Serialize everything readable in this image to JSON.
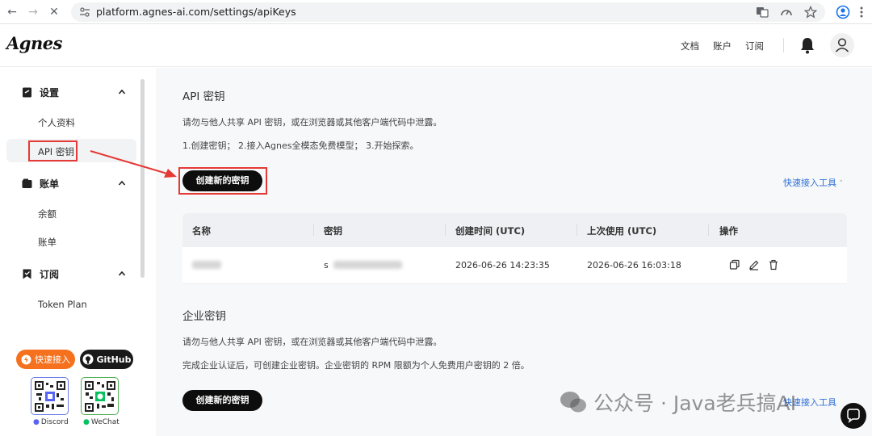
{
  "browser": {
    "url": "platform.agnes-ai.com/settings/apiKeys"
  },
  "header": {
    "logo": "Agnes",
    "links": [
      "文档",
      "账户",
      "订阅"
    ]
  },
  "sidebar": {
    "groups": [
      {
        "label": "设置",
        "items": [
          "个人资料",
          "API 密钥"
        ]
      },
      {
        "label": "账单",
        "items": [
          "余额",
          "账单"
        ]
      },
      {
        "label": "订阅",
        "items": [
          "Token Plan"
        ]
      }
    ],
    "active_item": "API 密钥",
    "quick_access_label": "快速接入",
    "github_label": "GitHub",
    "discord_label": "Discord",
    "wechat_label": "WeChat"
  },
  "main": {
    "api_section": {
      "title": "API 密钥",
      "warning": "请勿与他人共享 API 密钥，或在浏览器或其他客户端代码中泄露。",
      "steps": "1.创建密钥；  2.接入Agnes全模态免费模型；  3.开始探索。",
      "create_button": "创建新的密钥",
      "quick_link": "快速接入工具"
    },
    "table": {
      "headers": [
        "名称",
        "密钥",
        "创建时间 (UTC)",
        "上次使用 (UTC)",
        "操作"
      ],
      "rows": [
        {
          "name": "",
          "key": "s",
          "created": "2026-06-26 14:23:35",
          "last_used": "2026-06-26 16:03:18"
        }
      ]
    },
    "enterprise_section": {
      "title": "企业密钥",
      "warning": "请勿与他人共享 API 密钥，或在浏览器或其他客户端代码中泄露。",
      "note": "完成企业认证后，可创建企业密钥。企业密钥的 RPM 限额为个人免费用户密钥的 2 倍。",
      "create_button": "创建新的密钥",
      "quick_link": "快速接入工具"
    }
  },
  "watermark": "公众号 · Java老兵搞AI",
  "colors": {
    "highlight": "#e53935",
    "accent_orange": "#f5711e",
    "link": "#2f6fd6"
  }
}
